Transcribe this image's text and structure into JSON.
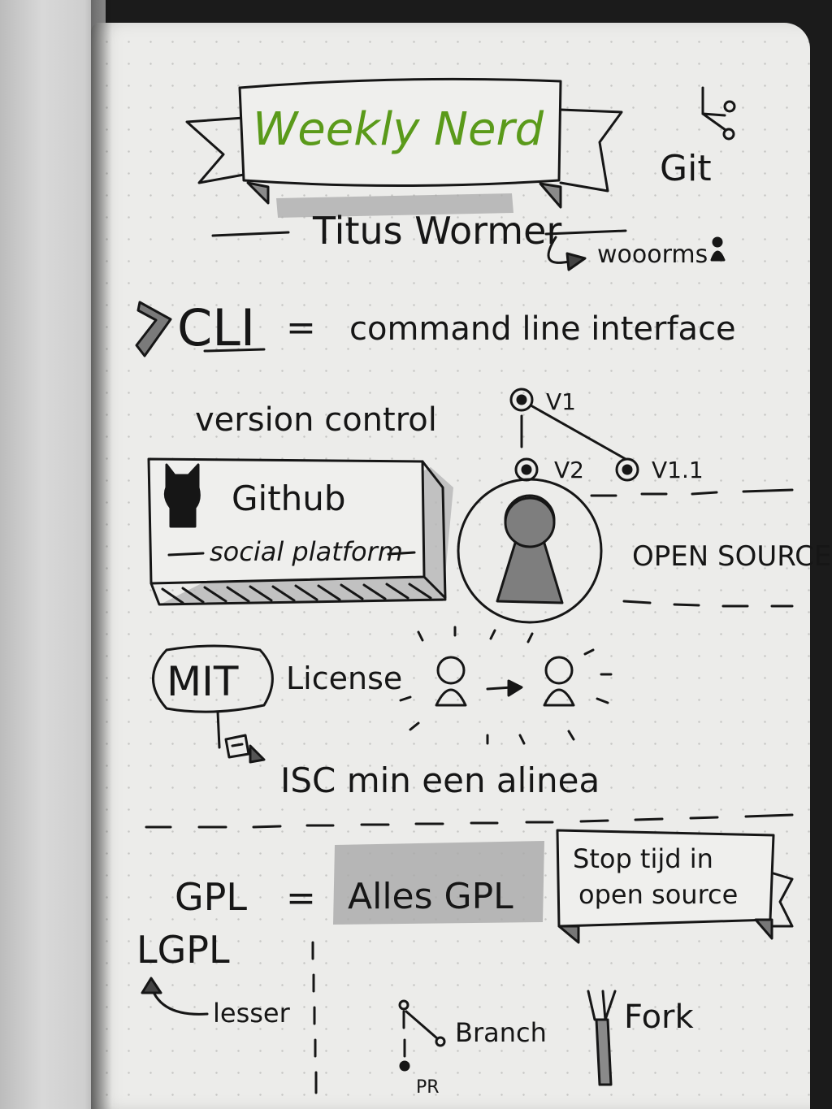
{
  "banner_title": "Weekly Nerd",
  "git_label": "Git",
  "speaker_name": "Titus Wormer",
  "handle": "wooorms",
  "cli": {
    "abbr": "CLI",
    "equals": "=",
    "definition": "command line interface"
  },
  "version_control": "version control",
  "versions": [
    "V1",
    "V2",
    "V1.1"
  ],
  "github": {
    "title": "Github",
    "subtitle": "social platform"
  },
  "open_source": "OPEN SOURCE",
  "mit": "MIT",
  "license": "License",
  "isc_line": "ISC min een alinea",
  "gpl_left": "GPL",
  "equals": "=",
  "gpl_right": "Alles GPL",
  "note_banner": [
    "Stop tijd in",
    "open source"
  ],
  "lgpl": "LGPL",
  "lesser": "lesser",
  "branch": "Branch",
  "pr": "PR",
  "fork": "Fork",
  "colors": {
    "accent_green": "#5a9a1a",
    "ink": "#161616",
    "highlight_gray": "#a9a9a9"
  }
}
